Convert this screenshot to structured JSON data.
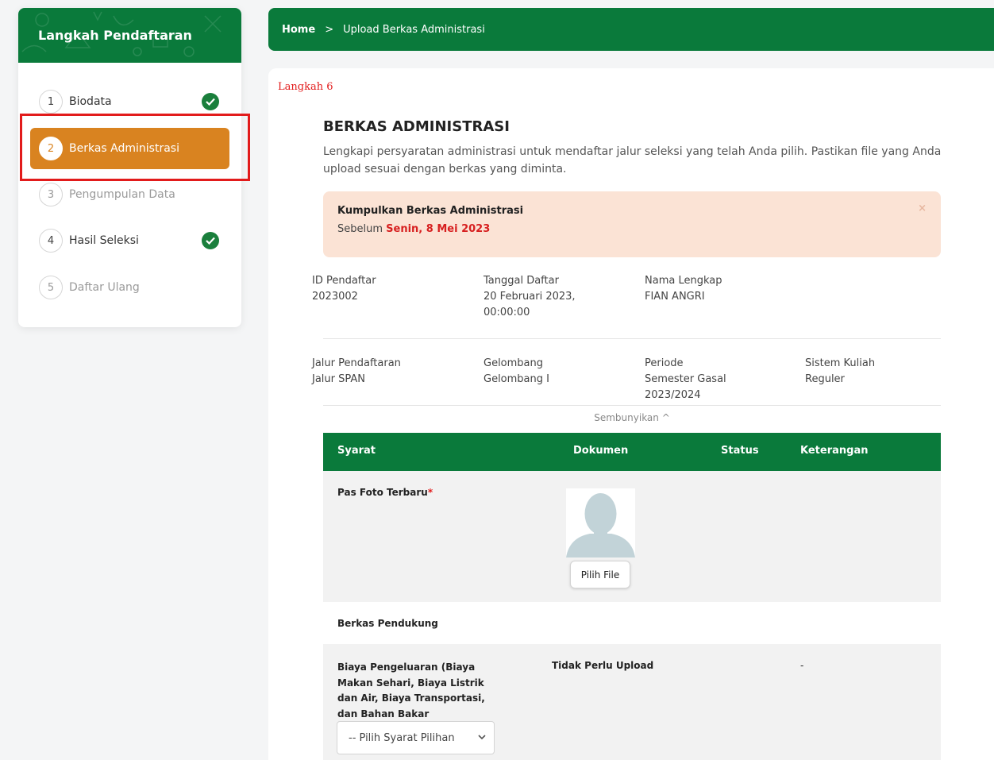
{
  "sidebar": {
    "title": "Langkah Pendaftaran",
    "steps": [
      {
        "num": "1",
        "label": "Biodata",
        "done": true
      },
      {
        "num": "2",
        "label": "Berkas Administrasi",
        "active": true
      },
      {
        "num": "3",
        "label": "Pengumpulan Data"
      },
      {
        "num": "4",
        "label": "Hasil Seleksi",
        "done": true
      },
      {
        "num": "5",
        "label": "Daftar Ulang"
      }
    ]
  },
  "breadcrumb": {
    "home": "Home",
    "separator": ">",
    "current": "Upload Berkas Administrasi"
  },
  "step_label": "Langkah 6",
  "page": {
    "title": "BERKAS ADMINISTRASI",
    "description": "Lengkapi persyaratan administrasi untuk mendaftar jalur seleksi yang telah Anda pilih. Pastikan file yang Anda upload sesuai dengan berkas yang diminta."
  },
  "alert": {
    "title": "Kumpulkan Berkas Administrasi",
    "prefix": "Sebelum",
    "date": "Senin, 8 Mei 2023",
    "close": "×"
  },
  "info": {
    "id_label": "ID Pendaftar",
    "id_value": "2023002",
    "tanggal_label": "Tanggal Daftar",
    "tanggal_value": "20 Februari 2023, 00:00:00",
    "nama_label": "Nama Lengkap",
    "nama_value": "FIAN ANGRI",
    "jalur_label": "Jalur Pendaftaran",
    "jalur_value": "Jalur SPAN",
    "gelombang_label": "Gelombang",
    "gelombang_value": "Gelombang I",
    "periode_label": "Periode",
    "periode_value": "Semester Gasal 2023/2024",
    "sistem_label": "Sistem Kuliah",
    "sistem_value": "Reguler"
  },
  "toggle_label": "Sembunyikan ^",
  "table": {
    "headers": {
      "syarat": "Syarat",
      "dokumen": "Dokumen",
      "status": "Status",
      "keterangan": "Keterangan"
    },
    "foto": {
      "label": "Pas Foto Terbaru",
      "required_mark": "*",
      "button": "Pilih File"
    },
    "section": "Berkas Pendukung",
    "biaya": {
      "label": "Biaya Pengeluaran (Biaya Makan Sehari, Biaya Listrik dan Air, Biaya Transportasi, dan Bahan Bakar",
      "dokumen": "Tidak Perlu Upload",
      "keterangan": "-",
      "select_value": "-- Pilih Syarat Pilihan"
    }
  },
  "colors": {
    "primary": "#0a7a3b",
    "active_step": "#d98320",
    "alert_bg": "#fbe3d5",
    "highlight": "#e21b1b"
  }
}
